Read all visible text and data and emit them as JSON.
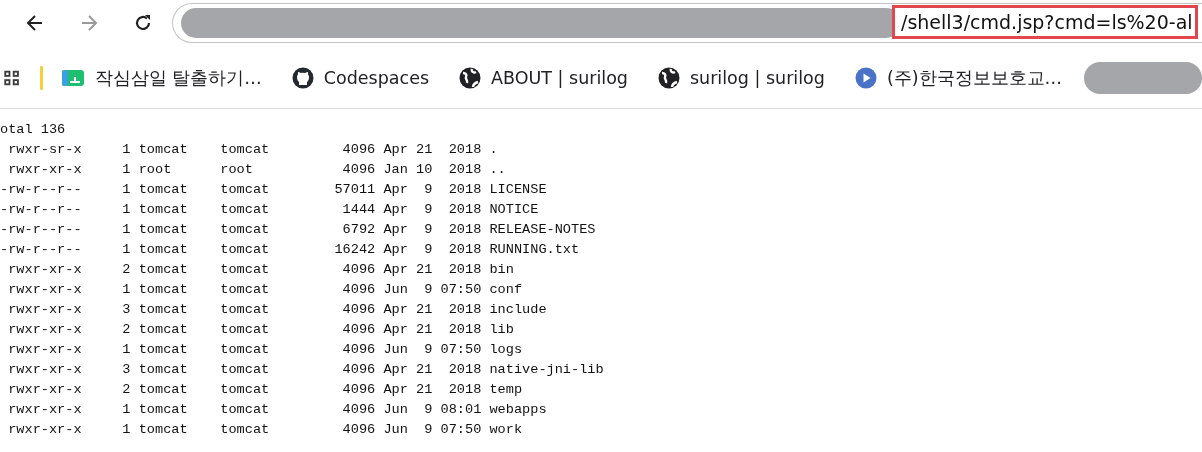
{
  "toolbar": {
    "nav": [
      {
        "kind": "back",
        "disabled": false
      },
      {
        "kind": "forward",
        "disabled": true
      },
      {
        "kind": "reload",
        "disabled": false
      }
    ],
    "url_visible": "/shell3/cmd.jsp?cmd=ls%20-al"
  },
  "bookmarks": [
    {
      "label": "작심삼일 탈출하기…",
      "kind": "app"
    },
    {
      "label": "Codespaces",
      "kind": "github"
    },
    {
      "label": "ABOUT | surilog",
      "kind": "globe"
    },
    {
      "label": "surilog | surilog",
      "kind": "globe"
    },
    {
      "label": "(주)한국정보보호교…",
      "kind": "play"
    }
  ],
  "output": {
    "lines": [
      "otal 136",
      " rwxr-sr-x     1 tomcat    tomcat         4096 Apr 21  2018 .",
      " rwxr-xr-x     1 root      root           4096 Jan 10  2018 ..",
      "-rw-r--r--     1 tomcat    tomcat        57011 Apr  9  2018 LICENSE",
      "-rw-r--r--     1 tomcat    tomcat         1444 Apr  9  2018 NOTICE",
      "-rw-r--r--     1 tomcat    tomcat         6792 Apr  9  2018 RELEASE-NOTES",
      "-rw-r--r--     1 tomcat    tomcat        16242 Apr  9  2018 RUNNING.txt",
      " rwxr-xr-x     2 tomcat    tomcat         4096 Apr 21  2018 bin",
      " rwxr-xr-x     1 tomcat    tomcat         4096 Jun  9 07:50 conf",
      " rwxr-xr-x     3 tomcat    tomcat         4096 Apr 21  2018 include",
      " rwxr-xr-x     2 tomcat    tomcat         4096 Apr 21  2018 lib",
      " rwxr-xr-x     1 tomcat    tomcat         4096 Jun  9 07:50 logs",
      " rwxr-xr-x     3 tomcat    tomcat         4096 Apr 21  2018 native-jni-lib",
      " rwxr-xr-x     2 tomcat    tomcat         4096 Apr 21  2018 temp",
      " rwxr-xr-x     1 tomcat    tomcat         4096 Jun  9 08:01 webapps",
      " rwxr-xr-x     1 tomcat    tomcat         4096 Jun  9 07:50 work"
    ]
  }
}
